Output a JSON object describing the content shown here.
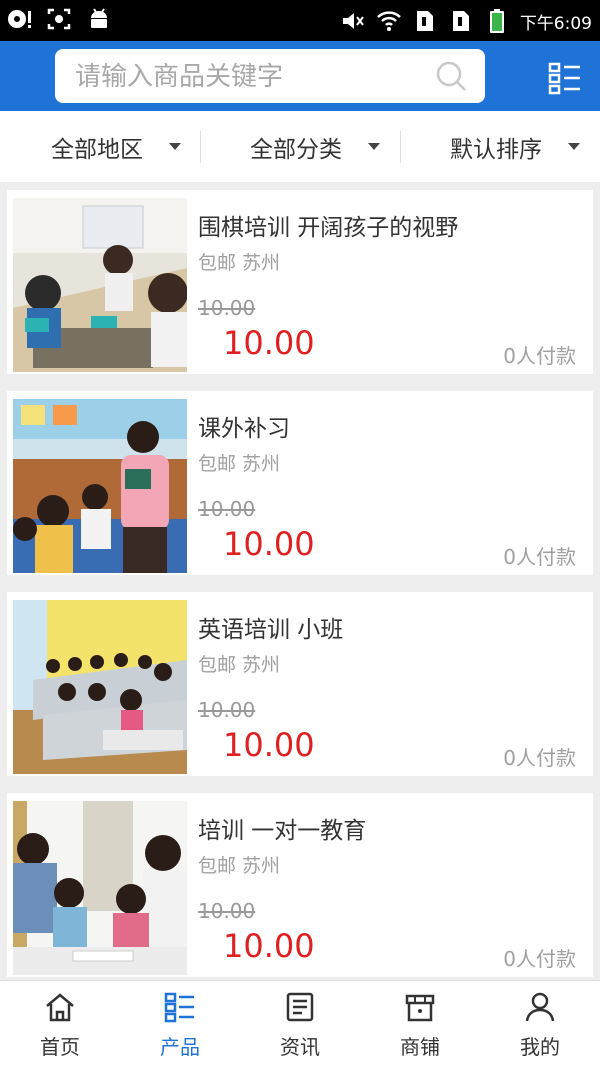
{
  "status_bar": {
    "time": "下午6:09",
    "left_icons": [
      "sim-disc-icon",
      "screenshot-icon",
      "android-icon"
    ],
    "right_icons": [
      "mute-icon",
      "wifi-icon",
      "sim1-icon",
      "sim2-icon",
      "battery-icon"
    ]
  },
  "header": {
    "search_placeholder": "请输入商品关键字",
    "accent_color": "#1f73d6"
  },
  "filters": [
    {
      "label": "全部地区"
    },
    {
      "label": "全部分类"
    },
    {
      "label": "默认排序"
    }
  ],
  "products": [
    {
      "title": "围棋培训 开阔孩子的视野",
      "location": "包邮 苏州",
      "original_price": "10.00",
      "price": "10.00",
      "paid": "0人付款"
    },
    {
      "title": "课外补习",
      "location": "包邮 苏州",
      "original_price": "10.00",
      "price": "10.00",
      "paid": "0人付款"
    },
    {
      "title": "英语培训 小班",
      "location": "包邮 苏州",
      "original_price": "10.00",
      "price": "10.00",
      "paid": "0人付款"
    },
    {
      "title": "培训 一对一教育",
      "location": "包邮 苏州",
      "original_price": "10.00",
      "price": "10.00",
      "paid": "0人付款"
    }
  ],
  "tabs": [
    {
      "label": "首页",
      "icon": "home-icon"
    },
    {
      "label": "产品",
      "icon": "product-list-icon",
      "active": true
    },
    {
      "label": "资讯",
      "icon": "news-icon"
    },
    {
      "label": "商铺",
      "icon": "shop-icon"
    },
    {
      "label": "我的",
      "icon": "user-icon"
    }
  ]
}
